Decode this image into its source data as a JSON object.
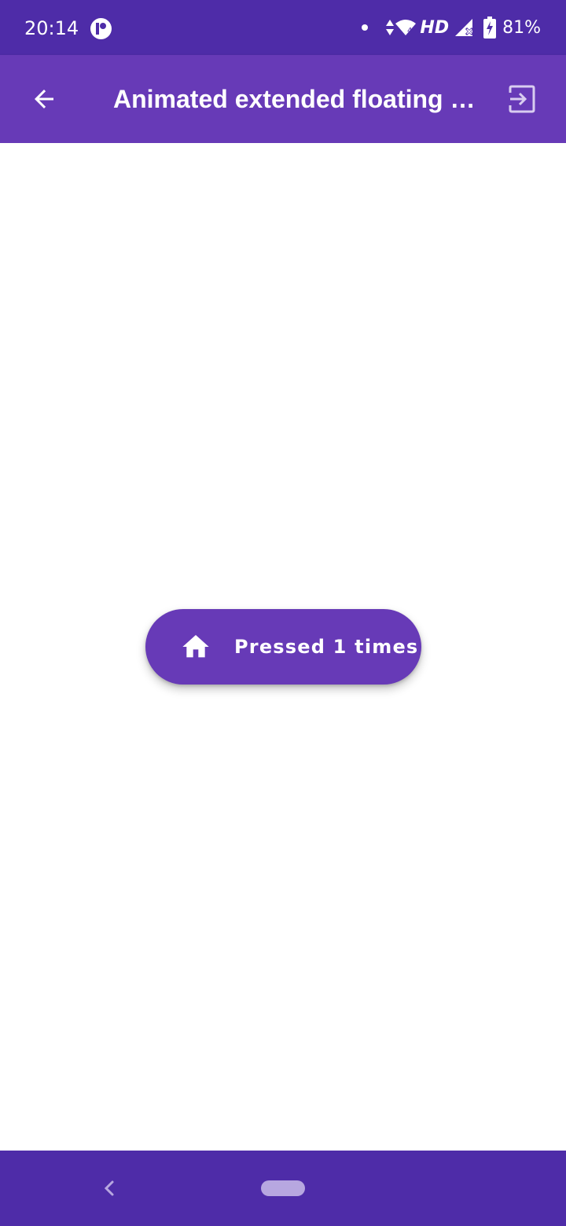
{
  "status_bar": {
    "time": "20:14",
    "network_label": "HD",
    "battery": "81%",
    "icons": [
      "app-notification-icon",
      "dot-icon",
      "data-arrows-icon",
      "wifi-icon",
      "signal-icon",
      "battery-charging-icon"
    ]
  },
  "app_bar": {
    "title": "Animated extended floating …",
    "back_icon": "arrow-back-icon",
    "action_icon": "exit-to-app-icon"
  },
  "fab": {
    "icon": "home-icon",
    "label": "Pressed 1 times"
  },
  "nav_bar": {
    "icons": [
      "nav-back-icon",
      "nav-home-pill"
    ]
  },
  "colors": {
    "status_bar": "#4e2ca8",
    "app_bar": "#673ab7",
    "fab": "#673ab7",
    "nav_bar": "#4e2ca8",
    "background": "#ffffff"
  }
}
